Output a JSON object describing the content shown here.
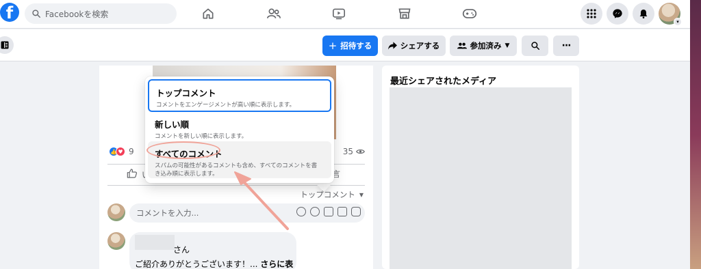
{
  "topbar": {
    "search_placeholder": "Facebookを検索",
    "nav_icons": [
      "home-icon",
      "friends-icon",
      "watch-icon",
      "marketplace-icon",
      "gaming-icon"
    ],
    "right_icons": [
      "menu-grid-icon",
      "messenger-icon",
      "bell-icon"
    ],
    "logo": "f"
  },
  "subbar": {
    "invite_label": "招待する",
    "share_label": "シェアする",
    "joined_label": "参加済み",
    "more_label": "···"
  },
  "post": {
    "reaction_count": "9",
    "view_count": "35",
    "like_fragment": "い",
    "action_right_fragment": "言",
    "sort_label": "トップコメント",
    "comment_placeholder": "コメントを入力...",
    "comment": {
      "name_suffix": "さん",
      "text": "ご紹介ありがとうございます！...",
      "see_more": "さらに表示"
    }
  },
  "media": {
    "title": "最近シェアされたメディア"
  },
  "dropdown": {
    "items": [
      {
        "title": "トップコメント",
        "desc": "コメントをエンゲージメントが高い順に表示します。"
      },
      {
        "title": "新しい順",
        "desc": "コメントを新しい順に表示します。"
      },
      {
        "title": "すべてのコメント",
        "desc_line1": "スパムの可能性があるコメントも含め、すべてのコメントを書",
        "desc_line2": "き込み順に表示します。"
      }
    ]
  },
  "colors": {
    "brand": "#1877f2",
    "annotation": "#f0a398"
  }
}
